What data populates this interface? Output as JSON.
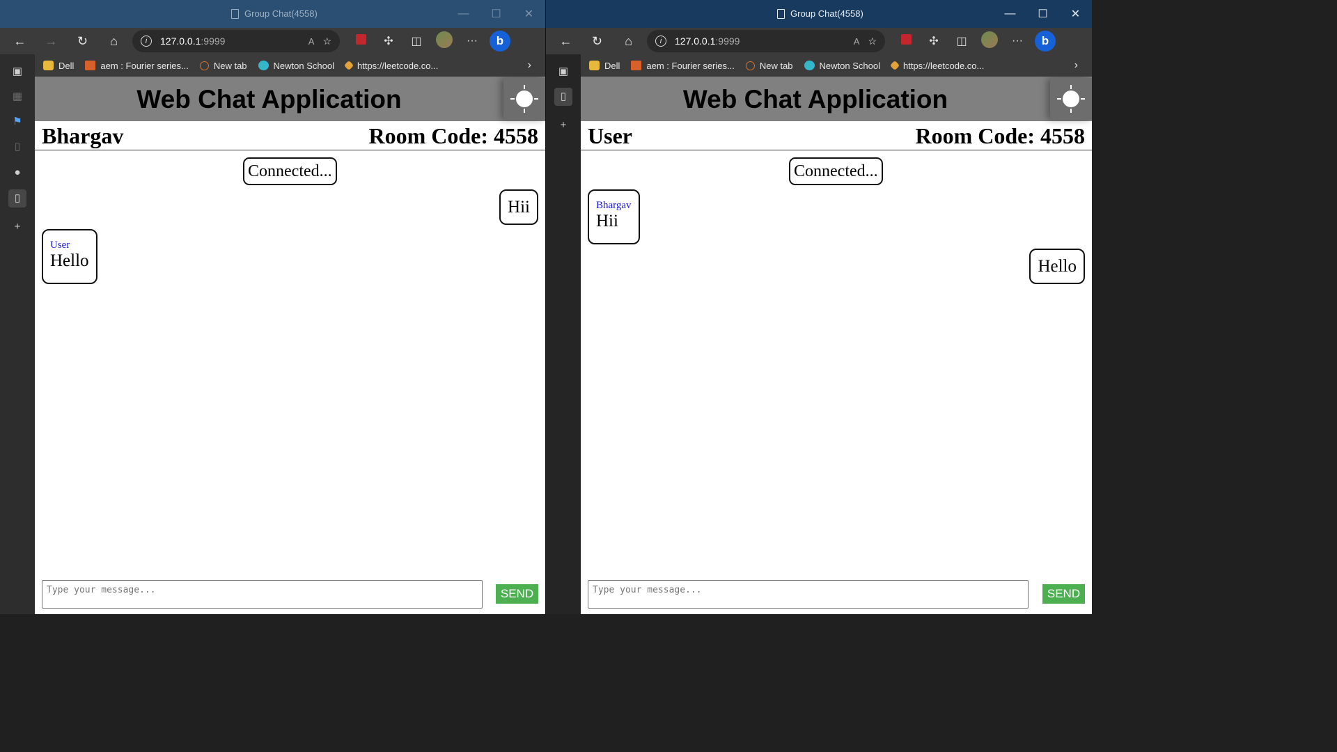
{
  "windows": [
    {
      "title": "Group Chat(4558)",
      "address": {
        "host": "127.0.0.1",
        "port": ":9999"
      },
      "bookmarks": [
        "Dell",
        "aem : Fourier series...",
        "New tab",
        "Newton School",
        "https://leetcode.co..."
      ],
      "app": {
        "title": "Web Chat Application",
        "username": "Bhargav",
        "room": "Room Code: 4558",
        "status": "Connected...",
        "messages": [
          {
            "direction": "outgoing",
            "sender": "",
            "text": "Hii"
          },
          {
            "direction": "incoming",
            "sender": "User",
            "text": "Hello"
          }
        ],
        "input_placeholder": "Type your message...",
        "send_label": "SEND"
      }
    },
    {
      "title": "Group Chat(4558)",
      "address": {
        "host": "127.0.0.1",
        "port": ":9999"
      },
      "bookmarks": [
        "Dell",
        "aem : Fourier series...",
        "New tab",
        "Newton School",
        "https://leetcode.co..."
      ],
      "app": {
        "title": "Web Chat Application",
        "username": "User",
        "room": "Room Code: 4558",
        "status": "Connected...",
        "messages": [
          {
            "direction": "incoming",
            "sender": "Bhargav",
            "text": "Hii"
          },
          {
            "direction": "outgoing",
            "sender": "",
            "text": "Hello"
          }
        ],
        "input_placeholder": "Type your message...",
        "send_label": "SEND"
      }
    }
  ],
  "colors": {
    "send_button": "#4caf50",
    "sender_name": "#1a1ad8",
    "app_header": "#808080"
  },
  "icons": [
    "back-icon",
    "forward-icon",
    "refresh-icon",
    "home-icon",
    "info-icon",
    "read-aloud-icon",
    "favorite-star-icon",
    "pdf-icon",
    "extensions-icon",
    "split-screen-icon",
    "profile-avatar-icon",
    "more-icon",
    "bing-icon",
    "theme-sun-icon"
  ]
}
